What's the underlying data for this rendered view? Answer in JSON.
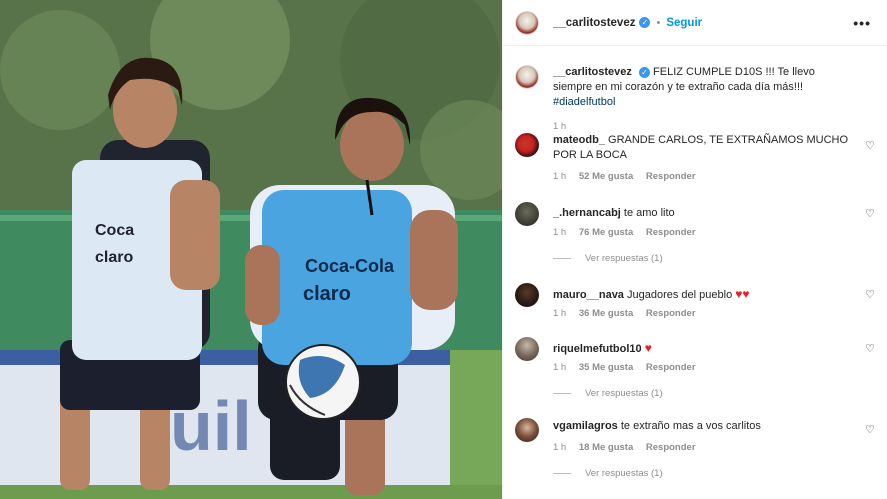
{
  "post": {
    "author": "__carlitostevez",
    "follow_label": "Seguir",
    "separator": "•",
    "more_icon": "more-options-icon",
    "photo_alt": "Foto de dos jugadores entrenando con la selección argentina",
    "caption": {
      "username": "__carlitostevez",
      "text": "FELIZ CUMPLE D10S !!! Te llevo siempre en mi corazón y te extraño cada día más!!!",
      "hashtag": "#diadelfutbol",
      "time": "1 h"
    }
  },
  "comments": [
    {
      "username": "mateodb_",
      "text": "GRANDE CARLOS, TE EXTRAÑAMOS MUCHO POR LA BOCA",
      "emoji": "",
      "time": "1 h",
      "likes": "52 Me gusta",
      "reply_label": "Responder",
      "replies_label": ""
    },
    {
      "username": "_.hernancabj",
      "text": "te amo lito",
      "emoji": "",
      "time": "1 h",
      "likes": "76 Me gusta",
      "reply_label": "Responder",
      "replies_label": "Ver respuestas (1)"
    },
    {
      "username": "mauro__nava",
      "text": "Jugadores del pueblo",
      "emoji": "♥♥",
      "time": "1 h",
      "likes": "36 Me gusta",
      "reply_label": "Responder",
      "replies_label": ""
    },
    {
      "username": "riquelmefutbol10",
      "text": "",
      "emoji": "♥",
      "time": "1 h",
      "likes": "35 Me gusta",
      "reply_label": "Responder",
      "replies_label": "Ver respuestas (1)"
    },
    {
      "username": "vgamilagros",
      "text": "te extraño mas a vos carlitos",
      "emoji": "",
      "time": "1 h",
      "likes": "18 Me gusta",
      "reply_label": "Responder",
      "replies_label": "Ver respuestas (1)"
    }
  ],
  "colors": {
    "link": "#0095f6",
    "hashtag": "#00376b",
    "muted": "#8e8e8e",
    "heart_red": "#ed1c24"
  }
}
